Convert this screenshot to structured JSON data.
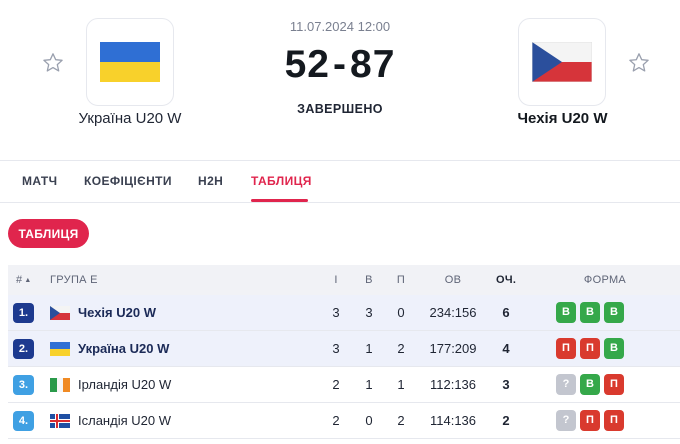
{
  "match": {
    "date": "11.07.2024 12:00",
    "score_home": "52",
    "score_sep": "-",
    "score_away": "87",
    "status": "ЗАВЕРШЕНО",
    "home_team": "Україна U20 W",
    "away_team": "Чехія U20 W"
  },
  "icons": {
    "favorite": "star-outline-icon",
    "sort": "sort-ascending-icon"
  },
  "tabs": [
    {
      "label": "МАТЧ",
      "active": false
    },
    {
      "label": "КОЕФІЦІЄНТИ",
      "active": false
    },
    {
      "label": "H2H",
      "active": false
    },
    {
      "label": "ТАБЛИЦЯ",
      "active": true
    }
  ],
  "sub_button": "ТАБЛИЦЯ",
  "table": {
    "headers": {
      "rank": "#",
      "group": "ГРУПА E",
      "played": "І",
      "won": "В",
      "lost": "П",
      "points": "ОВ",
      "pts": "ОЧ.",
      "form": "ФОРМА"
    },
    "rows": [
      {
        "rank": "1.",
        "team": "Чехія U20 W",
        "flag": "czechia",
        "played": "3",
        "won": "3",
        "lost": "0",
        "points": "234:156",
        "pts": "6",
        "form": [
          "В",
          "В",
          "В"
        ],
        "highlight": true
      },
      {
        "rank": "2.",
        "team": "Україна U20 W",
        "flag": "ukraine",
        "played": "3",
        "won": "1",
        "lost": "2",
        "points": "177:209",
        "pts": "4",
        "form": [
          "П",
          "П",
          "В"
        ],
        "highlight": true
      },
      {
        "rank": "3.",
        "team": "Ірландія U20 W",
        "flag": "ireland",
        "played": "2",
        "won": "1",
        "lost": "1",
        "points": "112:136",
        "pts": "3",
        "form": [
          "?",
          "В",
          "П"
        ],
        "highlight": false
      },
      {
        "rank": "4.",
        "team": "Ісландія U20 W",
        "flag": "iceland",
        "played": "2",
        "won": "0",
        "lost": "2",
        "points": "114:136",
        "pts": "2",
        "form": [
          "?",
          "П",
          "П"
        ],
        "highlight": false
      }
    ]
  },
  "colors": {
    "accent": "#e0254d",
    "rank_qualified": "#1d3a8f",
    "rank_other": "#3fa0e3",
    "form_win": "#35a84a",
    "form_loss": "#d93a2e",
    "form_unknown": "#c3c6cf",
    "row_highlight": "#eef1fb"
  }
}
